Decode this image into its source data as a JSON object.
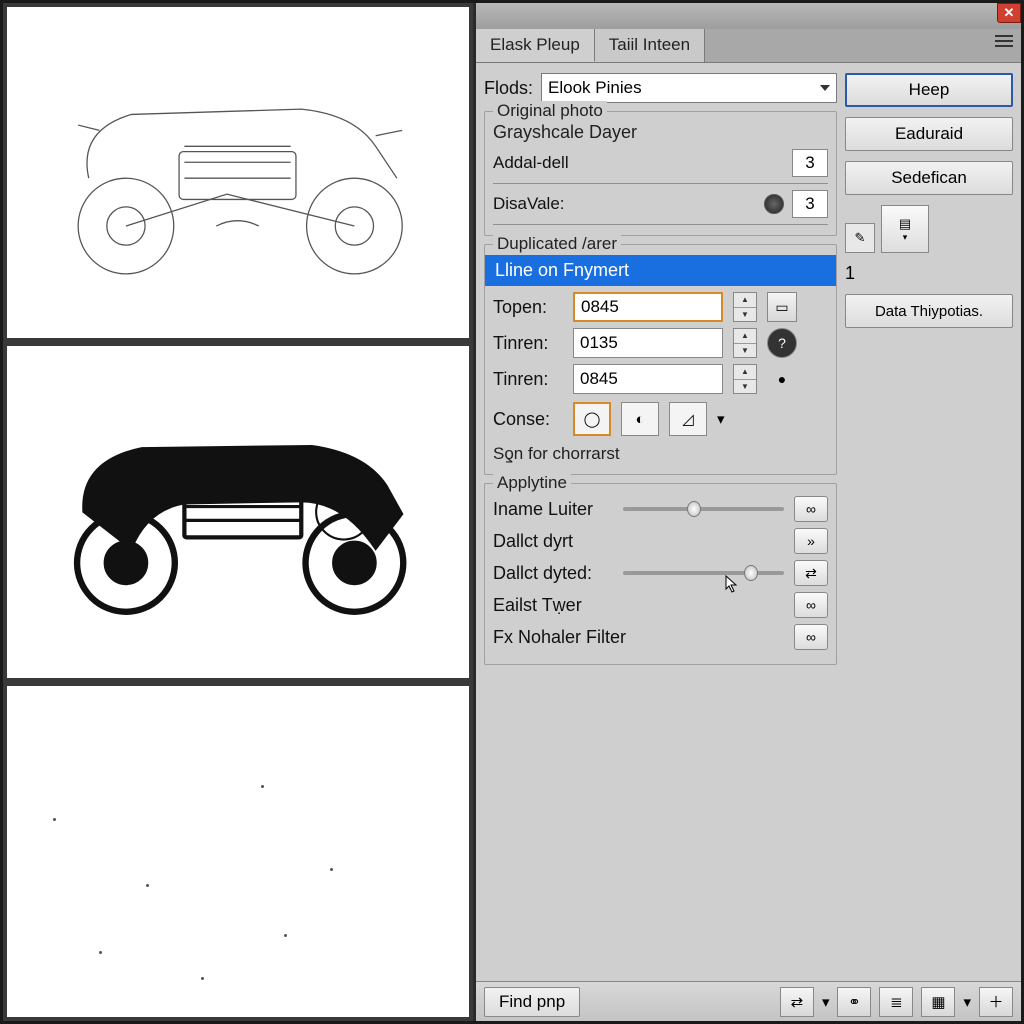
{
  "tabs": {
    "a": "Elask Pleup",
    "b": "Taiil Inteen"
  },
  "flods_label": "Flods:",
  "flods_value": "Elook Pinies",
  "buttons": {
    "heep": "Heep",
    "eaduraid": "Eaduraid",
    "sedefican": "Sedefican",
    "datathy": "Data Thiypotias.",
    "findpnp": "Find pnp"
  },
  "group1": {
    "title": "Original photo",
    "grayscale": "Grayshcale Dayer",
    "addal": "Addal-dell",
    "addal_val": "3",
    "disavale": "DisaVale:",
    "disavale_val": "3"
  },
  "group2": {
    "title": "Duplicated /arer",
    "selected": "Lline on Fnymert",
    "topen": "Topen:",
    "topen_val": "0845",
    "tinren1": "Tinren:",
    "tinren1_val": "0135",
    "tinren2": "Tinren:",
    "tinren2_val": "0845",
    "conse": "Conse:",
    "son": "Sƍn for chorrarst"
  },
  "group3": {
    "title": "Applytine",
    "iname": "Iname Luiter",
    "dallct1": "Dallct dyrt",
    "dallct2": "Dallct dyted:",
    "eailst": "Eailst Tẉer",
    "fx": "Fx Nohaler Filter"
  },
  "side_num": "1",
  "icons": {
    "info": "ⓘ",
    "play": "»",
    "cycle": "↻",
    "screen": "▭",
    "swap": "⇄",
    "list": "≣",
    "grid": "▦",
    "plus": "＋"
  }
}
